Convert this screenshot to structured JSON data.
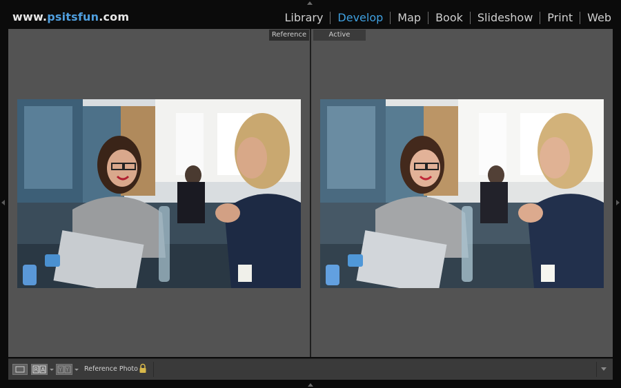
{
  "header": {
    "brand_prefix": "www.",
    "brand_name": "psitsfun",
    "brand_suffix": ".com",
    "modules": [
      {
        "label": "Library",
        "active": false
      },
      {
        "label": "Develop",
        "active": true
      },
      {
        "label": "Map",
        "active": false
      },
      {
        "label": "Book",
        "active": false
      },
      {
        "label": "Slideshow",
        "active": false
      },
      {
        "label": "Print",
        "active": false
      },
      {
        "label": "Web",
        "active": false
      }
    ]
  },
  "compare": {
    "reference_label": "Reference",
    "active_label": "Active"
  },
  "toolbar": {
    "reference_photo_label": "Reference Photo :",
    "view_buttons": [
      "loupe-view",
      "reference-active-view",
      "before-after-view"
    ],
    "lock_icon": "padlock-icon"
  },
  "colors": {
    "accent": "#3fa0e0",
    "panel_bg": "#535353",
    "app_bg": "#0b0b0b"
  }
}
